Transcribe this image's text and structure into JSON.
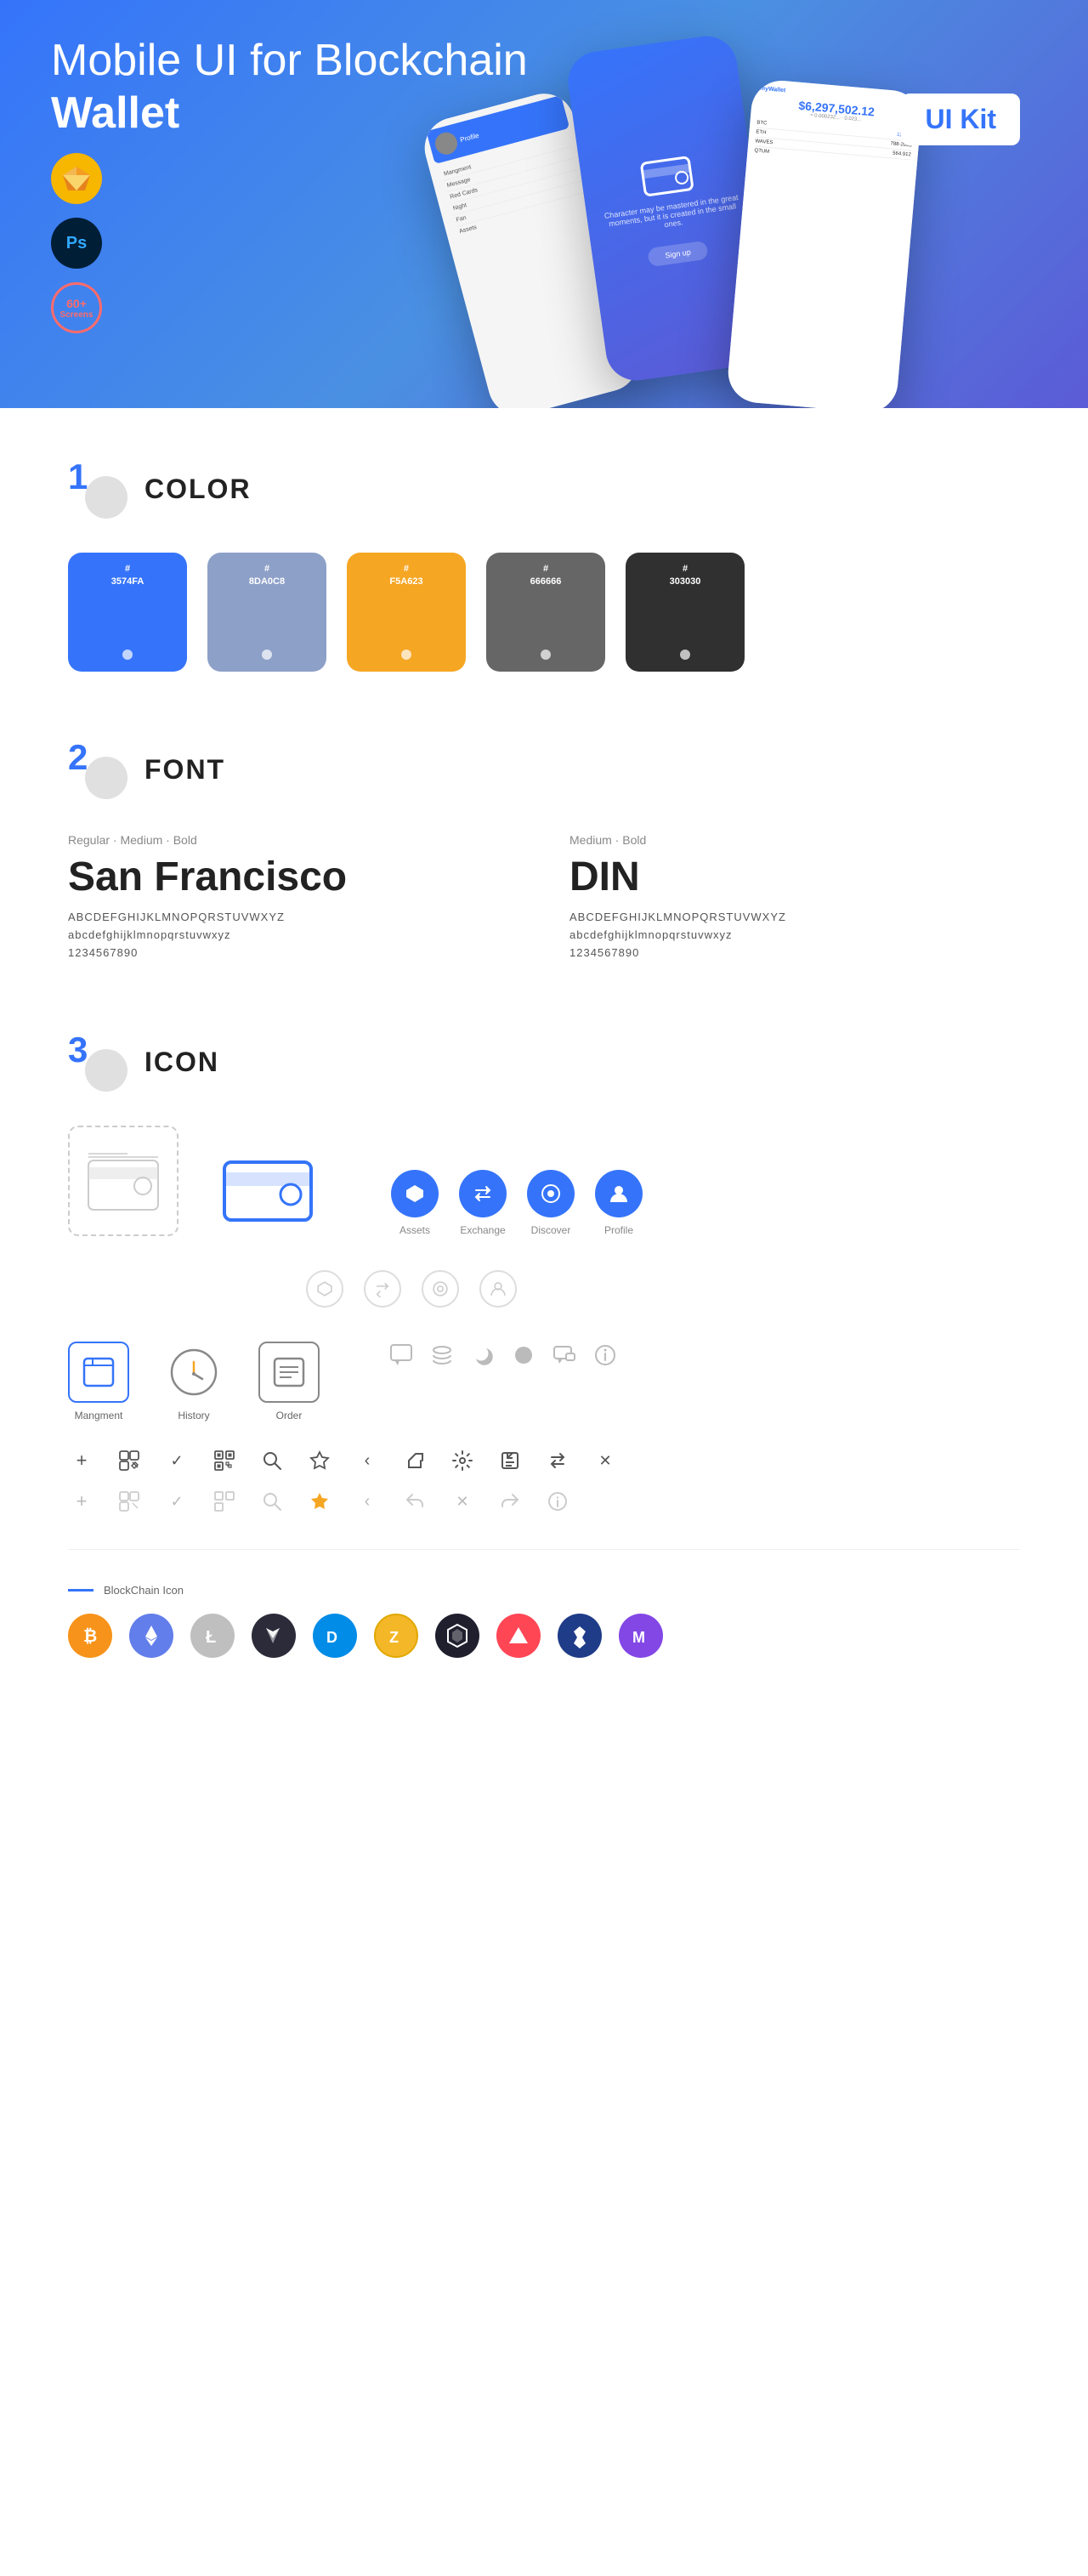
{
  "hero": {
    "title_normal": "Mobile UI for Blockchain ",
    "title_bold": "Wallet",
    "badge": "UI Kit",
    "badges": [
      "sketch",
      "ps",
      "60+\nScreens"
    ]
  },
  "sections": {
    "color": {
      "number": "1",
      "word": "ONE",
      "title": "COLOR",
      "swatches": [
        {
          "hex": "#3574FA",
          "label": "#\n3574FA",
          "dot": true
        },
        {
          "hex": "#8DA0C8",
          "label": "#\n8DA0C8",
          "dot": true
        },
        {
          "hex": "#F5A623",
          "label": "#\nF5A623",
          "dot": true
        },
        {
          "hex": "#666666",
          "label": "#\n666666",
          "dot": true
        },
        {
          "hex": "#303030",
          "label": "#\n303030",
          "dot": true
        }
      ]
    },
    "font": {
      "number": "2",
      "word": "TWO",
      "title": "FONT",
      "fonts": [
        {
          "meta": "Regular · Medium · Bold",
          "name": "San Francisco",
          "uppercase": "ABCDEFGHIJKLMNOPQRSTUVWXYZ",
          "lowercase": "abcdefghijklmnopqrstuvwxyz",
          "numbers": "1234567890"
        },
        {
          "meta": "Medium · Bold",
          "name": "DIN",
          "uppercase": "ABCDEFGHIJKLMNOPQRSTUVWXYZ",
          "lowercase": "abcdefghijklmnopqrstuvwxyz",
          "numbers": "1234567890"
        }
      ]
    },
    "icon": {
      "number": "3",
      "word": "THREE",
      "title": "ICON",
      "nav_icons": [
        {
          "label": "Assets",
          "symbol": "◆"
        },
        {
          "label": "Exchange",
          "symbol": "⇌"
        },
        {
          "label": "Discover",
          "symbol": "●"
        },
        {
          "label": "Profile",
          "symbol": "◑"
        }
      ],
      "app_icons": [
        {
          "label": "Mangment",
          "type": "rect"
        },
        {
          "label": "History",
          "type": "clock"
        },
        {
          "label": "Order",
          "type": "list"
        }
      ],
      "small_icons": [
        "+",
        "⊞",
        "✓",
        "⊟",
        "🔍",
        "☆",
        "<",
        "≪",
        "⚙",
        "⊡",
        "⇌",
        "✕"
      ],
      "blockchain_label": "BlockChain Icon",
      "crypto_logos": [
        {
          "name": "Bitcoin",
          "bg": "#F7931A",
          "color": "white",
          "symbol": "₿"
        },
        {
          "name": "Ethereum",
          "bg": "#627EEA",
          "color": "white",
          "symbol": "Ξ"
        },
        {
          "name": "Litecoin",
          "bg": "#A5A9B4",
          "color": "white",
          "symbol": "Ł"
        },
        {
          "name": "Bytom",
          "bg": "#1B1B2A",
          "color": "white",
          "symbol": "◈"
        },
        {
          "name": "Dash",
          "bg": "#008CE7",
          "color": "white",
          "symbol": "D"
        },
        {
          "name": "Zcash",
          "bg": "#F4B728",
          "color": "white",
          "symbol": "Z"
        },
        {
          "name": "IOTA",
          "bg": "#1F1F2E",
          "color": "white",
          "symbol": "⬡"
        },
        {
          "name": "Ark",
          "bg": "#FF4655",
          "color": "white",
          "symbol": "▲"
        },
        {
          "name": "Kyber",
          "bg": "#1F3C88",
          "color": "white",
          "symbol": "◇"
        },
        {
          "name": "Matic",
          "bg": "#8247E5",
          "color": "white",
          "symbol": "M"
        }
      ]
    }
  }
}
